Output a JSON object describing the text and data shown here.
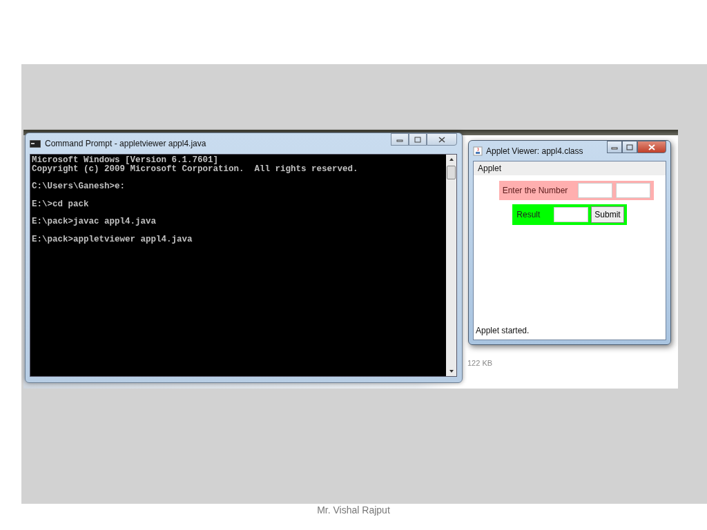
{
  "background_window": {
    "file_sizes": [
      "122 KB"
    ]
  },
  "command_prompt": {
    "title": "Command Prompt - appletviewer  appl4.java",
    "paragraphs": [
      [
        "Microsoft Windows [Version 6.1.7601]",
        "Copyright (c) 2009 Microsoft Corporation.  All rights reserved."
      ],
      [
        "C:\\Users\\Ganesh>e:"
      ],
      [
        "E:\\>cd pack"
      ],
      [
        "E:\\pack>javac appl4.java"
      ],
      [
        "E:\\pack>appletviewer appl4.java"
      ]
    ]
  },
  "applet_viewer": {
    "title": "Applet Viewer: appl4.class",
    "menu": [
      "Applet"
    ],
    "number_label": "Enter the Number",
    "result_label": "Result",
    "submit_button": "Submit",
    "status": "Applet started."
  },
  "slide": {
    "footer": "Mr. Vishal Rajput"
  }
}
